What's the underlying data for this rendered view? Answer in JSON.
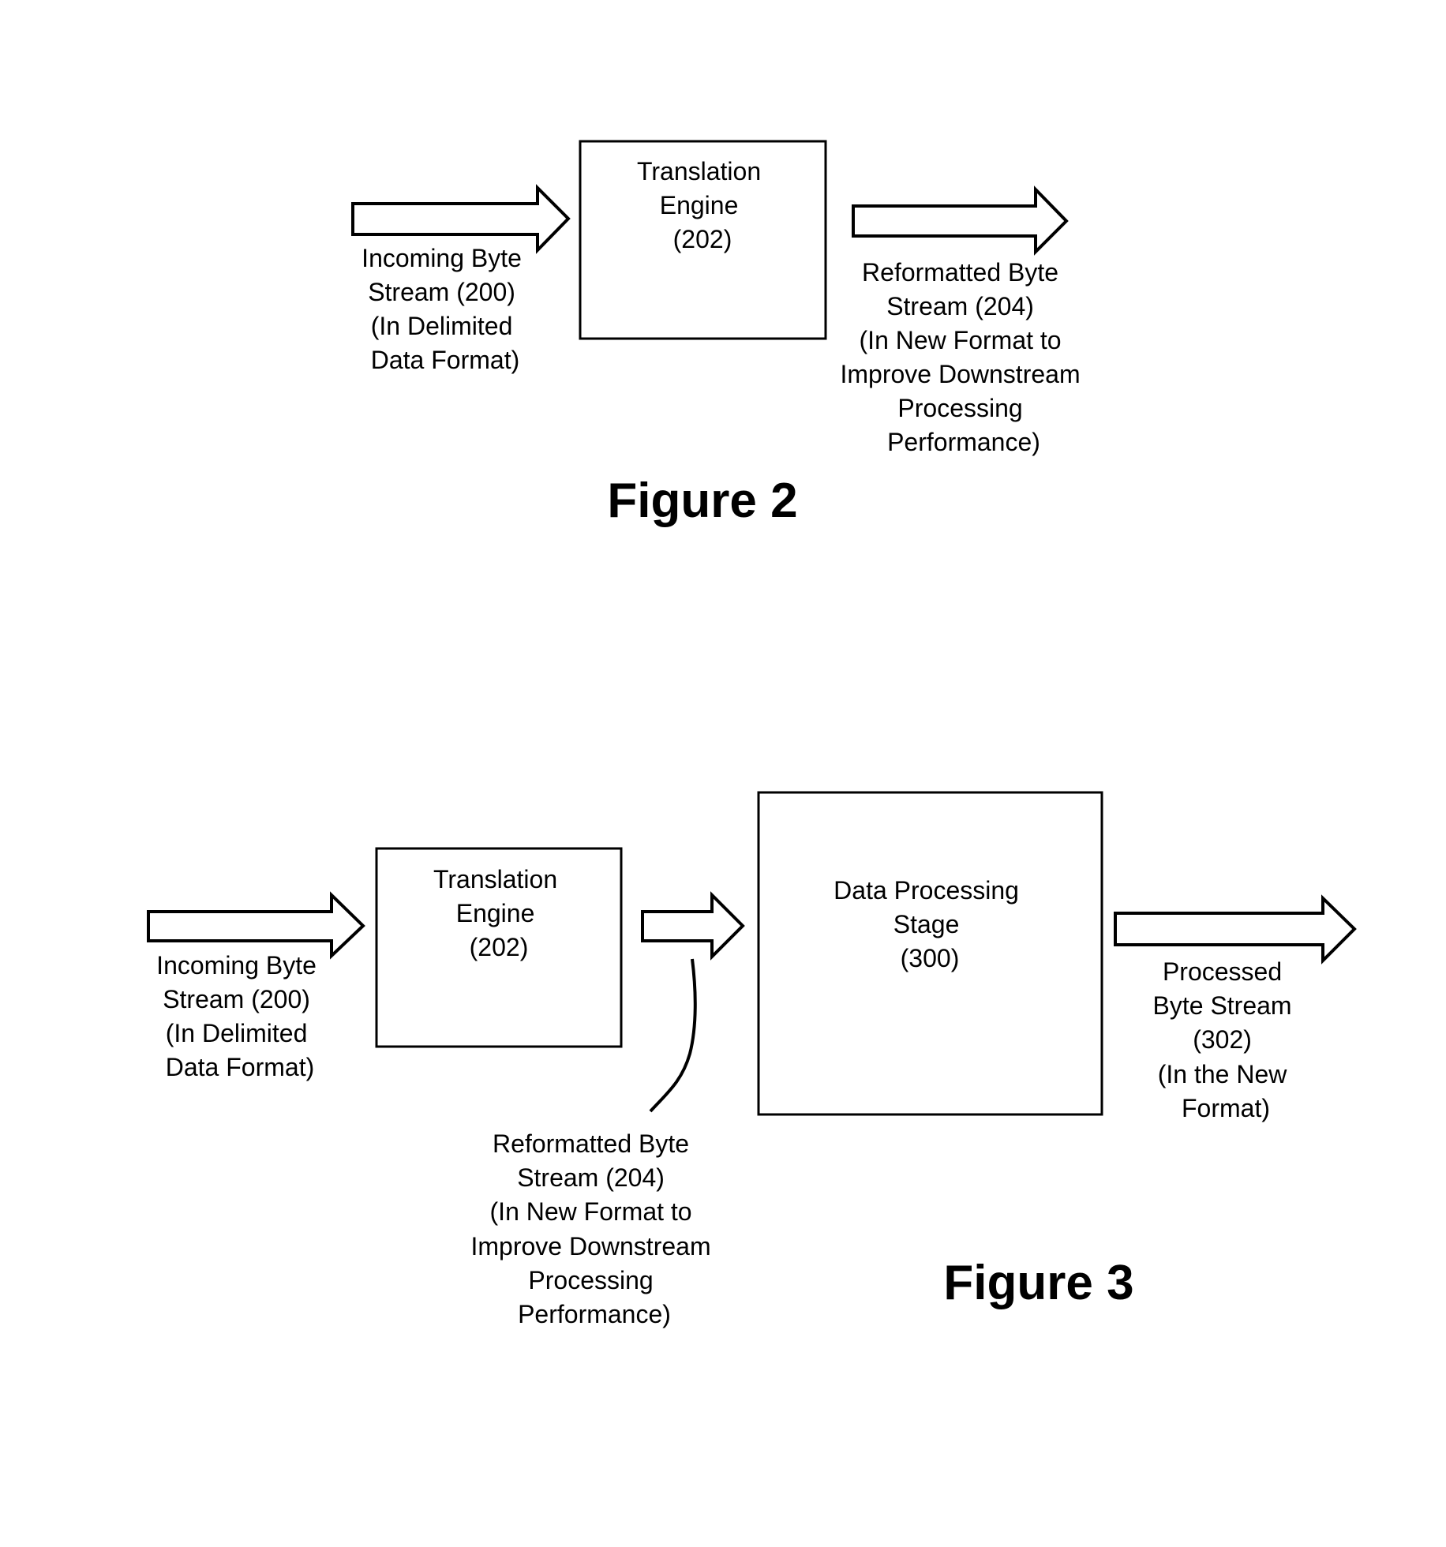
{
  "figure2": {
    "caption": "Figure 2",
    "input_label": [
      "Incoming Byte",
      "Stream (200)",
      "(In Delimited",
      "Data Format)"
    ],
    "engine_label": [
      "Translation",
      "Engine",
      "(202)"
    ],
    "output_label": [
      "Reformatted Byte",
      "Stream (204)",
      "(In New Format to",
      "Improve Downstream",
      "Processing",
      "Performance)"
    ]
  },
  "figure3": {
    "caption": "Figure 3",
    "input_label": [
      "Incoming Byte",
      "Stream (200)",
      "(In Delimited",
      "Data Format)"
    ],
    "engine_label": [
      "Translation",
      "Engine",
      "(202)"
    ],
    "intermediate_label": [
      "Reformatted Byte",
      "Stream (204)",
      "(In New Format to",
      "Improve Downstream",
      "Processing",
      "Performance)"
    ],
    "stage_label": [
      "Data Processing",
      "Stage",
      "(300)"
    ],
    "output_label": [
      "Processed",
      "Byte Stream",
      "(302)",
      "(In the New",
      "Format)"
    ]
  },
  "colors": {
    "ink": "#000000",
    "background": "#ffffff"
  }
}
